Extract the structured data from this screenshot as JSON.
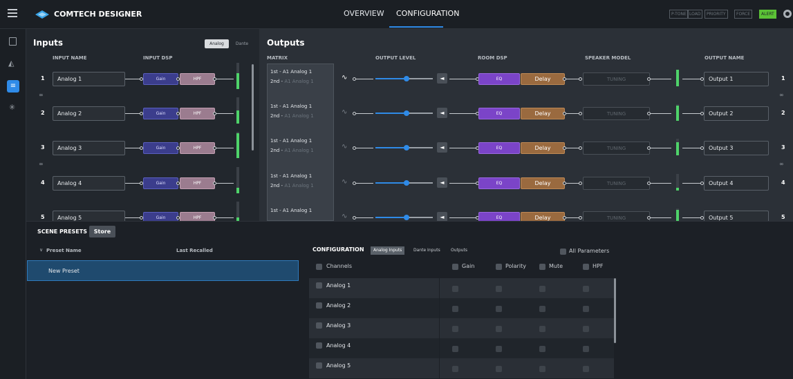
{
  "app": {
    "title": "COMTECH DESIGNER"
  },
  "nav": {
    "tabs": [
      {
        "label": "OVERVIEW"
      },
      {
        "label": "CONFIGURATION",
        "active": true
      }
    ]
  },
  "status_buttons": [
    "P-TONE",
    "LOAD",
    "PRIORITY",
    "FORCE",
    "ALERT"
  ],
  "colors": {
    "accent": "#2f8be8",
    "alert": "#5bc236",
    "meter": "#4fd36a",
    "gain": "#3b3d8c",
    "hpf": "#9b7c8f",
    "eq": "#7b44c8",
    "delay": "#9a6a3f"
  },
  "inputs": {
    "title": "Inputs",
    "toggle": {
      "analog": "Analog",
      "dante": "Dante"
    },
    "headers": {
      "name": "INPUT NAME",
      "dsp": "INPUT DSP"
    },
    "rows": [
      {
        "num": "1",
        "name": "Analog 1",
        "gain": "Gain",
        "hpf": "HPF",
        "meter": 0.6
      },
      {
        "num": "2",
        "name": "Analog 2",
        "gain": "Gain",
        "hpf": "HPF",
        "meter": 0.5
      },
      {
        "num": "3",
        "name": "Analog 3",
        "gain": "Gain",
        "hpf": "HPF",
        "meter": 0.95
      },
      {
        "num": "4",
        "name": "Analog 4",
        "gain": "Gain",
        "hpf": "HPF",
        "meter": 0.2
      },
      {
        "num": "5",
        "name": "Analog 5",
        "gain": "Gain",
        "hpf": "HPF",
        "meter": 0.4
      }
    ]
  },
  "outputs": {
    "title": "Outputs",
    "headers": {
      "matrix": "MATRIX",
      "level": "OUTPUT LEVEL",
      "room": "ROOM DSP",
      "speaker": "SPEAKER MODEL",
      "name": "OUTPUT NAME"
    },
    "rows": [
      {
        "num": "1",
        "first": "1st - A1 Analog 1",
        "second_prefix": "2nd - ",
        "second": "A1 Analog 1",
        "eq": "EQ",
        "delay": "Delay",
        "tuning": "TUNING",
        "name": "Output 1",
        "meter": 1.0
      },
      {
        "num": "2",
        "first": "1st - A1 Analog 1",
        "second_prefix": "2nd - ",
        "second": "A1 Analog 1",
        "eq": "EQ",
        "delay": "Delay",
        "tuning": "TUNING",
        "name": "Output 2",
        "meter": 0.9
      },
      {
        "num": "3",
        "first": "1st - A1 Analog 1",
        "second_prefix": "2nd - ",
        "second": "A1 Analog 1",
        "eq": "EQ",
        "delay": "Delay",
        "tuning": "TUNING",
        "name": "Output 3",
        "meter": 0.8
      },
      {
        "num": "4",
        "first": "1st - A1 Analog 1",
        "second_prefix": "2nd - ",
        "second": "A1 Analog 1",
        "eq": "EQ",
        "delay": "Delay",
        "tuning": "TUNING",
        "name": "Output 4",
        "meter": 0.15
      },
      {
        "num": "5",
        "first": "1st - A1 Analog 1",
        "second_prefix": "",
        "second": "",
        "eq": "EQ",
        "delay": "Delay",
        "tuning": "TUNING",
        "name": "Output 5",
        "meter": 0.9
      }
    ]
  },
  "presets": {
    "title": "SCENE PRESETS",
    "store": "Store",
    "col_name": "Preset Name",
    "col_recalled": "Last Recalled",
    "items": [
      "New Preset"
    ]
  },
  "config": {
    "title": "CONFIGURATION",
    "tabs": [
      "Analog Inputs",
      "Dante Inputs",
      "Outputs"
    ],
    "all_params": "All Parameters",
    "columns": [
      "Channels",
      "Gain",
      "Polarity",
      "Mute",
      "HPF"
    ],
    "rows": [
      "Analog 1",
      "Analog 2",
      "Analog 3",
      "Analog 4",
      "Analog 5"
    ]
  }
}
